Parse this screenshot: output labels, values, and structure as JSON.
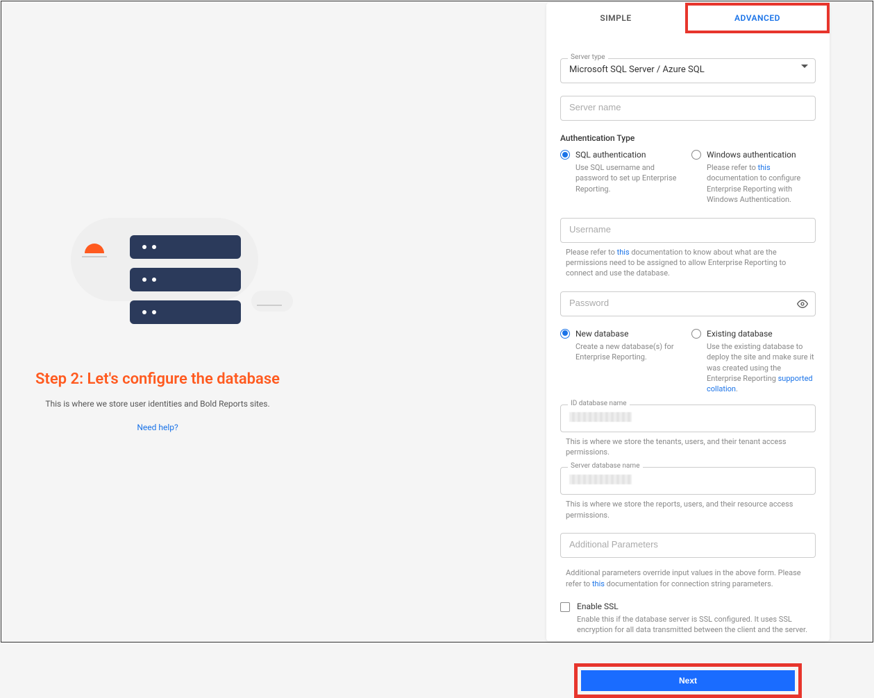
{
  "left": {
    "title": "Step 2: Let's configure the database",
    "subtitle": "This is where we store user identities and Bold Reports sites.",
    "help": "Need help?"
  },
  "tabs": {
    "simple": "SIMPLE",
    "advanced": "ADVANCED"
  },
  "server_type": {
    "label": "Server type",
    "value": "Microsoft SQL Server / Azure SQL"
  },
  "server_name_ph": "Server name",
  "auth": {
    "label": "Authentication Type",
    "sql": {
      "title": "SQL authentication",
      "desc": "Use SQL username and password to set up Enterprise Reporting."
    },
    "win": {
      "title": "Windows authentication",
      "desc_a": "Please refer to ",
      "link": "this",
      "desc_b": " documentation to configure Enterprise Reporting with Windows Authentication."
    }
  },
  "username_ph": "Username",
  "username_hint_a": "Please refer to ",
  "username_hint_link": "this",
  "username_hint_b": " documentation to know about what are the permissions need to be assigned to allow Enterprise Reporting to connect and use the database.",
  "password_ph": "Password",
  "db": {
    "new": {
      "title": "New database",
      "desc": "Create a new database(s) for Enterprise Reporting."
    },
    "existing": {
      "title": "Existing database",
      "desc_a": "Use the existing database to deploy the site and make sure it was created using the Enterprise Reporting ",
      "link": "supported collation",
      "desc_b": "."
    }
  },
  "id_db": {
    "label": "ID database name",
    "hint": "This is where we store the tenants, users, and their tenant access permissions."
  },
  "server_db": {
    "label": "Server database name",
    "hint": "This is where we store the reports, users, and their resource access permissions."
  },
  "additional_ph": "Additional Parameters",
  "additional_hint_a": "Additional parameters override input values in the above form. Please refer to ",
  "additional_hint_link": "this",
  "additional_hint_b": " documentation for connection string parameters.",
  "ssl": {
    "title": "Enable SSL",
    "desc": "Enable this if the database server is SSL configured. It uses SSL encryption for all data transmitted between the client and the server."
  },
  "next": "Next"
}
